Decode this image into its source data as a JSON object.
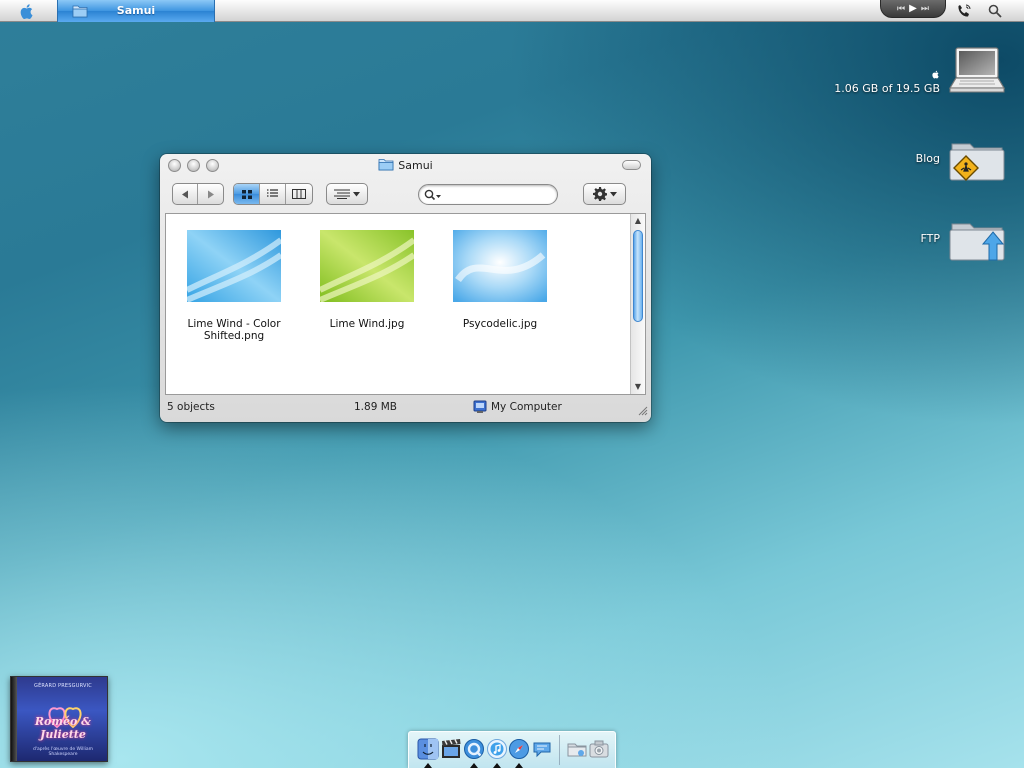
{
  "menubar": {
    "apple_icon": "apple-logo-icon",
    "active_task": "Samui",
    "media_controls": {
      "prev": "⏮",
      "play": "▶",
      "next": "⏭"
    }
  },
  "desktop": {
    "drive": {
      "label": "1.06 GB of 19.5 GB",
      "icon": "laptop-icon"
    },
    "blog": {
      "label": "Blog",
      "icon": "public-folder-icon"
    },
    "ftp": {
      "label": "FTP",
      "icon": "upload-folder-icon"
    }
  },
  "window": {
    "title": "Samui",
    "search": {
      "value": "",
      "placeholder": ""
    },
    "files": [
      {
        "name": "Lime Wind - Color Shifted.png",
        "thumb_colors": [
          "#3fa7e6",
          "#bde6fa"
        ]
      },
      {
        "name": "Lime Wind.jpg",
        "thumb_colors": [
          "#8cc42a",
          "#e3f29a"
        ]
      },
      {
        "name": "Psycodelic.jpg",
        "thumb_colors": [
          "#5fb1ec",
          "#e9f6fd"
        ]
      }
    ],
    "status": {
      "count": "5 objects",
      "size": "1.89 MB",
      "location": "My Computer"
    }
  },
  "album": {
    "top_text": "GÉRARD PRESGURVIC",
    "title": "Roméo & Juliette",
    "bottom_text": "d'après l'œuvre de William Shakespeare"
  },
  "dock": {
    "items": [
      "finder-icon",
      "imovie-icon",
      "quicktime-icon",
      "itunes-icon",
      "safari-icon",
      "ichat-icon",
      "trash-folder-icon",
      "photo-icon"
    ]
  },
  "colors": {
    "accent": "#3b8ddb",
    "desktop_top": "#0d4a66",
    "desktop_bottom": "#a8e6ef"
  }
}
